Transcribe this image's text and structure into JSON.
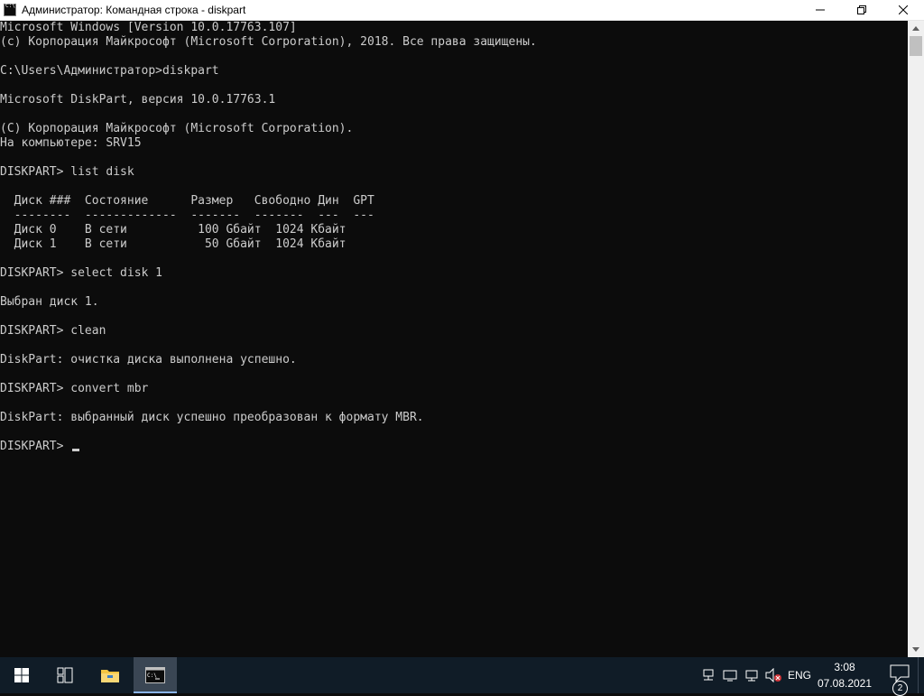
{
  "window": {
    "title": "Администратор: Командная строка - diskpart"
  },
  "console": {
    "lines": [
      "Microsoft Windows [Version 10.0.17763.107]",
      "(c) Корпорация Майкрософт (Microsoft Corporation), 2018. Все права защищены.",
      "",
      "C:\\Users\\Администратор>diskpart",
      "",
      "Microsoft DiskPart, версия 10.0.17763.1",
      "",
      "(C) Корпорация Майкрософт (Microsoft Corporation).",
      "На компьютере: SRV15",
      "",
      "DISKPART> list disk",
      "",
      "  Диск ###  Состояние      Размер   Свободно Дин  GPT",
      "  --------  -------------  -------  -------  ---  ---",
      "  Диск 0    В сети          100 Gбайт  1024 Кбайт",
      "  Диск 1    В сети           50 Gбайт  1024 Кбайт",
      "",
      "DISKPART> select disk 1",
      "",
      "Выбран диск 1.",
      "",
      "DISKPART> clean",
      "",
      "DiskPart: очистка диска выполнена успешно.",
      "",
      "DISKPART> convert mbr",
      "",
      "DiskPart: выбранный диск успешно преобразован к формату MBR.",
      ""
    ],
    "prompt": "DISKPART> "
  },
  "taskbar": {
    "tray_language": "ENG",
    "clock_time": "3:08",
    "clock_date": "07.08.2021",
    "notification_count": "2"
  },
  "colors": {
    "console_bg": "#0c0c0c",
    "console_text": "#cccccc",
    "taskbar_bg": "#101c27"
  }
}
